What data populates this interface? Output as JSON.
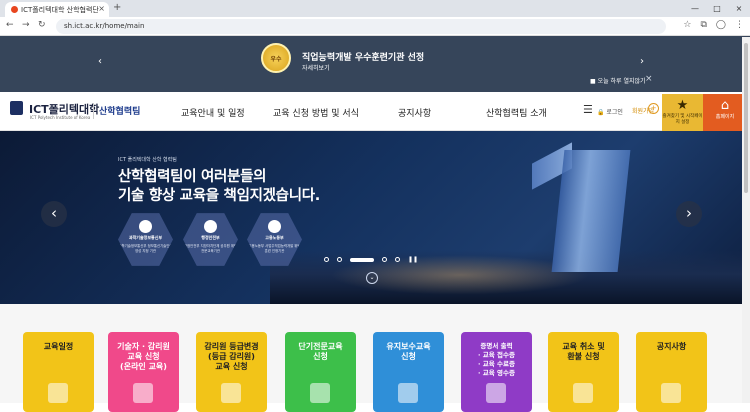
{
  "browser": {
    "tab_title": "ICT폴리텍대학 산학협력단",
    "url": "sh.ict.ac.kr/home/main",
    "tab_close": "×",
    "new_tab": "+",
    "win_min": "—",
    "win_max": "□",
    "win_close": "×",
    "back": "←",
    "forward": "→",
    "reload": "↻"
  },
  "banner": {
    "seal_text": "우수",
    "title": "직업능력개발 우수훈련기관 선정",
    "link": "자세히보기",
    "prev": "‹",
    "next": "›",
    "dismiss": "■ 오늘 하루 열지않기",
    "close": "×"
  },
  "header": {
    "logo_main": "ICT폴리텍대학",
    "logo_sub": "ICT Polytech Institute of Korea",
    "team": "산학협력팀",
    "menu": [
      "교육안내 및 일정",
      "교육 신청 방법 및 서식",
      "공지사항",
      "산학협력팀 소개"
    ],
    "hamburger": "☰",
    "login": "🔒 로그인",
    "signup": "회원가입",
    "signup_icon": "+",
    "quick1_icon": "★",
    "quick1": "즐겨찾기 및 시작페이지 설정",
    "quick2_icon": "⌂",
    "quick2": "홈페이지"
  },
  "hero": {
    "small": "ICT 폴리텍대학 산학 협력팀",
    "line1": "산학협력팀이 여러분들의",
    "line2": "기술 향상 교육을 책임지겠습니다.",
    "orgs": [
      {
        "name": "과학기술정보통신부",
        "desc": "과학기술정보통신부 정보통신기술인력양성 지정 기관"
      },
      {
        "name": "행정안전부",
        "desc": "행정안전부 지방자치단체 공무원 위탁 전문교육기관"
      },
      {
        "name": "고용노동부",
        "desc": "고용노동부 사업주직업능력개발 위탁훈련 인정기관"
      }
    ],
    "arrow_prev": "‹",
    "arrow_next": "›",
    "pause": "❚❚",
    "scroll": "⌄"
  },
  "cards": [
    {
      "label": "교육일정",
      "bg": "#f2c418",
      "fg": "#222222"
    },
    {
      "label": "기술자 · 감리원\n교육 신청\n(온라인 교육)",
      "bg": "#f0498a",
      "fg": "#ffffff"
    },
    {
      "label": "감리원 등급변경\n(등급 감리원)\n교육 신청",
      "bg": "#f2c418",
      "fg": "#222222"
    },
    {
      "label": "단기전문교육\n신청",
      "bg": "#3dbf4a",
      "fg": "#ffffff"
    },
    {
      "label": "유지보수교육\n신청",
      "bg": "#2f8fd8",
      "fg": "#ffffff"
    },
    {
      "label": "증명서 출력\n· 교육 접수증\n· 교육 수료증\n· 교육 영수증",
      "bg": "#8f3bc6",
      "fg": "#ffffff"
    },
    {
      "label": "교육 취소 및\n환불 신청",
      "bg": "#f2c418",
      "fg": "#222222"
    },
    {
      "label": "공지사항",
      "bg": "#f2c418",
      "fg": "#222222"
    }
  ]
}
